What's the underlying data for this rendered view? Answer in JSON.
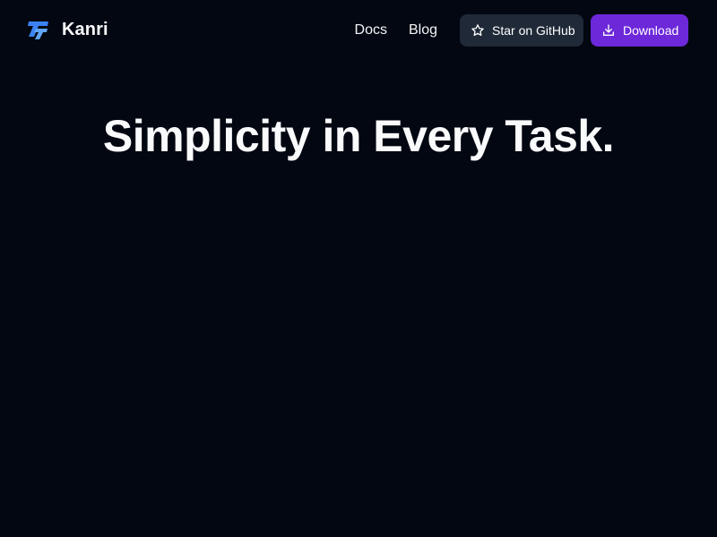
{
  "header": {
    "brand": {
      "logo_icon": "kanri-logo-icon",
      "name": "Kanri"
    },
    "nav": {
      "links": [
        {
          "label": "Docs"
        },
        {
          "label": "Blog"
        }
      ],
      "github_button": {
        "label": "Star on GitHub",
        "icon": "star-icon"
      },
      "download_button": {
        "label": "Download",
        "icon": "download-icon"
      }
    }
  },
  "hero": {
    "title": "Simplicity in Every Task."
  },
  "colors": {
    "background": "#030712",
    "logo_blue": "#3b82f6",
    "github_button_bg": "#1f2937",
    "download_button_bg": "#6d28d9",
    "text": "#f9fafb"
  }
}
